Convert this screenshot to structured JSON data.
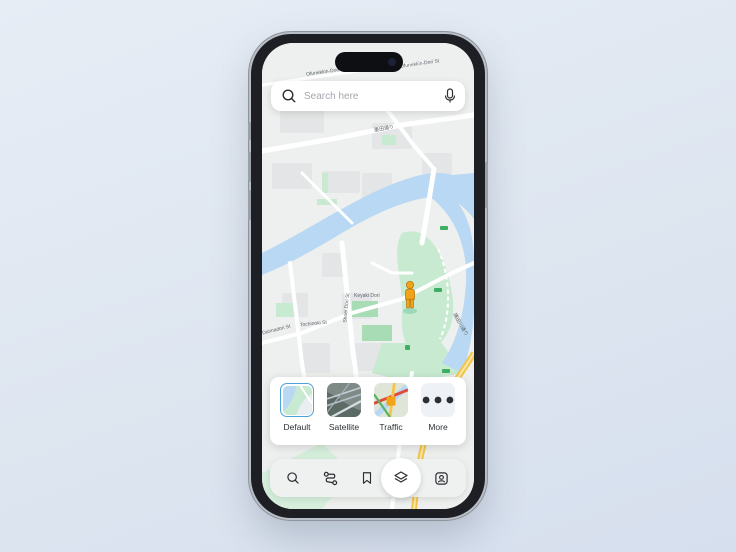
{
  "search": {
    "placeholder": "Search here"
  },
  "map": {
    "labels": {
      "street_top": "Ofunekkin-Dori St",
      "street_top2": "Ofunekkin-Dori St",
      "route_jp": "墨田通り",
      "keyaki": "Keyaki Dori",
      "shoei": "Shoei Dori St",
      "tochinoki": "Tochinoki St",
      "daimadori": "Daimadori St",
      "route_jp2": "隅田川通り"
    },
    "pin": "pegman-icon"
  },
  "map_layers": {
    "options": [
      {
        "label": "Default",
        "selected": true
      },
      {
        "label": "Satellite",
        "selected": false
      },
      {
        "label": "Traffic",
        "selected": false
      },
      {
        "label": "More",
        "selected": false
      }
    ]
  },
  "tab_bar": {
    "tabs": [
      "search-icon",
      "route-icon",
      "bookmark-icon",
      "layers-icon",
      "profile-icon"
    ],
    "active": "layers-icon"
  },
  "colors": {
    "water": "#b9d8f3",
    "park": "#bfe5c9",
    "accent": "#4aa3da",
    "road_highway": "#f3c64a",
    "pegman": "#f2a418"
  }
}
